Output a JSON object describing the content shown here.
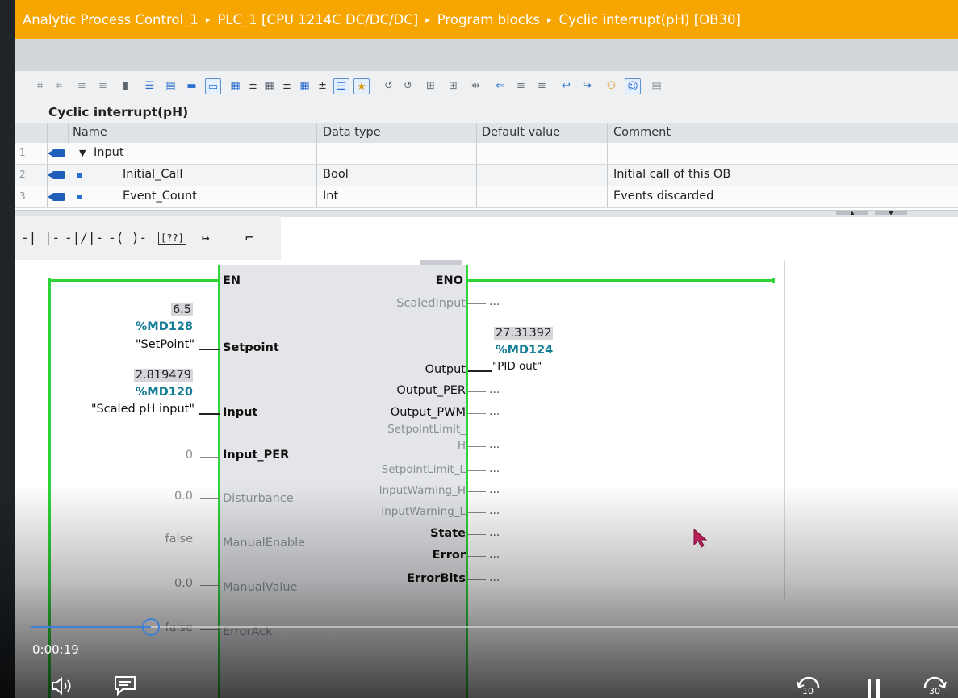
{
  "breadcrumb": {
    "items": [
      "Analytic Process Control_1",
      "PLC_1 [CPU 1214C DC/DC/DC]",
      "Program blocks",
      "Cyclic interrupt(pH) [OB30]"
    ],
    "separator": "▸"
  },
  "interface": {
    "title": "Cyclic interrupt(pH)",
    "columns": [
      "Name",
      "Data type",
      "Default value",
      "Comment"
    ],
    "rows": [
      {
        "num": "1",
        "name": "Input",
        "type": "",
        "default": "",
        "comment": ""
      },
      {
        "num": "2",
        "name": "Initial_Call",
        "type": "Bool",
        "default": "",
        "comment": "Initial call of this OB"
      },
      {
        "num": "3",
        "name": "Event_Count",
        "type": "Int",
        "default": "",
        "comment": "Events discarded"
      }
    ]
  },
  "lad_toolbar": [
    "-| |-",
    "-|/|-",
    "-( )-",
    "[??]",
    "↦",
    "⌐"
  ],
  "block": {
    "en": "EN",
    "eno": "ENO",
    "inputs": {
      "setpoint": {
        "label": "Setpoint",
        "value": "6.5",
        "address": "%MD128",
        "tag": "\"SetPoint\""
      },
      "input": {
        "label": "Input",
        "value": "2.819479",
        "address": "%MD120",
        "tag": "\"Scaled pH input\""
      },
      "input_per": {
        "label": "Input_PER",
        "const": "0"
      },
      "disturbance": {
        "label": "Disturbance",
        "const": "0.0"
      },
      "manual_enable": {
        "label": "ManualEnable",
        "const": "false"
      },
      "manual_value": {
        "label": "ManualValue",
        "const": "0.0"
      },
      "error_ack": {
        "label": "ErrorAck",
        "const": "false"
      }
    },
    "outputs": {
      "scaled_input": {
        "label": "ScaledInput",
        "open": "..."
      },
      "output": {
        "label": "Output",
        "value": "27.31392",
        "address": "%MD124",
        "tag": "\"PID out\""
      },
      "output_per": {
        "label": "Output_PER",
        "open": "..."
      },
      "output_pwm": {
        "label": "Output_PWM",
        "open": "..."
      },
      "setpoint_limit_h_1": {
        "label": "SetpointLimit_",
        "open": ""
      },
      "setpoint_limit_h_2": {
        "label": "H",
        "open": "..."
      },
      "setpoint_limit_l": {
        "label": "SetpointLimit_L",
        "open": "..."
      },
      "input_warning_h": {
        "label": "InputWarning_H",
        "open": "..."
      },
      "input_warning_l": {
        "label": "InputWarning_L",
        "open": "..."
      },
      "state": {
        "label": "State",
        "open": "..."
      },
      "error": {
        "label": "Error",
        "open": "..."
      },
      "error_bits": {
        "label": "ErrorBits",
        "open": "..."
      }
    }
  },
  "player": {
    "time": "0:00:19",
    "progress_fraction": 0.13,
    "rewind_label": "10",
    "forward_label": "30"
  },
  "colors": {
    "breadcrumb_bg": "#f7a500",
    "rail_green": "#2fd43a",
    "address_teal": "#137c96",
    "progress_blue": "#3d7fd8"
  }
}
